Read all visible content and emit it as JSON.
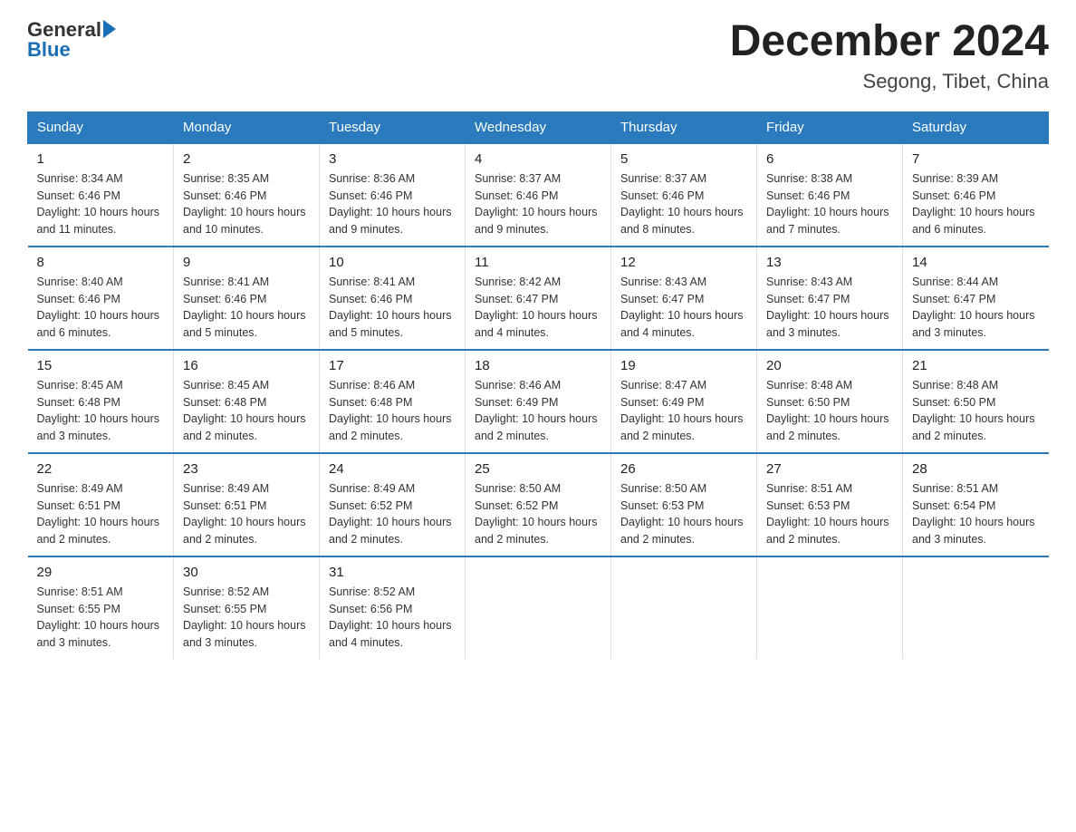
{
  "logo": {
    "general": "General",
    "blue": "Blue"
  },
  "title": "December 2024",
  "subtitle": "Segong, Tibet, China",
  "days_of_week": [
    "Sunday",
    "Monday",
    "Tuesday",
    "Wednesday",
    "Thursday",
    "Friday",
    "Saturday"
  ],
  "weeks": [
    [
      {
        "day": "1",
        "sunrise": "8:34 AM",
        "sunset": "6:46 PM",
        "daylight": "10 hours and 11 minutes."
      },
      {
        "day": "2",
        "sunrise": "8:35 AM",
        "sunset": "6:46 PM",
        "daylight": "10 hours and 10 minutes."
      },
      {
        "day": "3",
        "sunrise": "8:36 AM",
        "sunset": "6:46 PM",
        "daylight": "10 hours and 9 minutes."
      },
      {
        "day": "4",
        "sunrise": "8:37 AM",
        "sunset": "6:46 PM",
        "daylight": "10 hours and 9 minutes."
      },
      {
        "day": "5",
        "sunrise": "8:37 AM",
        "sunset": "6:46 PM",
        "daylight": "10 hours and 8 minutes."
      },
      {
        "day": "6",
        "sunrise": "8:38 AM",
        "sunset": "6:46 PM",
        "daylight": "10 hours and 7 minutes."
      },
      {
        "day": "7",
        "sunrise": "8:39 AM",
        "sunset": "6:46 PM",
        "daylight": "10 hours and 6 minutes."
      }
    ],
    [
      {
        "day": "8",
        "sunrise": "8:40 AM",
        "sunset": "6:46 PM",
        "daylight": "10 hours and 6 minutes."
      },
      {
        "day": "9",
        "sunrise": "8:41 AM",
        "sunset": "6:46 PM",
        "daylight": "10 hours and 5 minutes."
      },
      {
        "day": "10",
        "sunrise": "8:41 AM",
        "sunset": "6:46 PM",
        "daylight": "10 hours and 5 minutes."
      },
      {
        "day": "11",
        "sunrise": "8:42 AM",
        "sunset": "6:47 PM",
        "daylight": "10 hours and 4 minutes."
      },
      {
        "day": "12",
        "sunrise": "8:43 AM",
        "sunset": "6:47 PM",
        "daylight": "10 hours and 4 minutes."
      },
      {
        "day": "13",
        "sunrise": "8:43 AM",
        "sunset": "6:47 PM",
        "daylight": "10 hours and 3 minutes."
      },
      {
        "day": "14",
        "sunrise": "8:44 AM",
        "sunset": "6:47 PM",
        "daylight": "10 hours and 3 minutes."
      }
    ],
    [
      {
        "day": "15",
        "sunrise": "8:45 AM",
        "sunset": "6:48 PM",
        "daylight": "10 hours and 3 minutes."
      },
      {
        "day": "16",
        "sunrise": "8:45 AM",
        "sunset": "6:48 PM",
        "daylight": "10 hours and 2 minutes."
      },
      {
        "day": "17",
        "sunrise": "8:46 AM",
        "sunset": "6:48 PM",
        "daylight": "10 hours and 2 minutes."
      },
      {
        "day": "18",
        "sunrise": "8:46 AM",
        "sunset": "6:49 PM",
        "daylight": "10 hours and 2 minutes."
      },
      {
        "day": "19",
        "sunrise": "8:47 AM",
        "sunset": "6:49 PM",
        "daylight": "10 hours and 2 minutes."
      },
      {
        "day": "20",
        "sunrise": "8:48 AM",
        "sunset": "6:50 PM",
        "daylight": "10 hours and 2 minutes."
      },
      {
        "day": "21",
        "sunrise": "8:48 AM",
        "sunset": "6:50 PM",
        "daylight": "10 hours and 2 minutes."
      }
    ],
    [
      {
        "day": "22",
        "sunrise": "8:49 AM",
        "sunset": "6:51 PM",
        "daylight": "10 hours and 2 minutes."
      },
      {
        "day": "23",
        "sunrise": "8:49 AM",
        "sunset": "6:51 PM",
        "daylight": "10 hours and 2 minutes."
      },
      {
        "day": "24",
        "sunrise": "8:49 AM",
        "sunset": "6:52 PM",
        "daylight": "10 hours and 2 minutes."
      },
      {
        "day": "25",
        "sunrise": "8:50 AM",
        "sunset": "6:52 PM",
        "daylight": "10 hours and 2 minutes."
      },
      {
        "day": "26",
        "sunrise": "8:50 AM",
        "sunset": "6:53 PM",
        "daylight": "10 hours and 2 minutes."
      },
      {
        "day": "27",
        "sunrise": "8:51 AM",
        "sunset": "6:53 PM",
        "daylight": "10 hours and 2 minutes."
      },
      {
        "day": "28",
        "sunrise": "8:51 AM",
        "sunset": "6:54 PM",
        "daylight": "10 hours and 3 minutes."
      }
    ],
    [
      {
        "day": "29",
        "sunrise": "8:51 AM",
        "sunset": "6:55 PM",
        "daylight": "10 hours and 3 minutes."
      },
      {
        "day": "30",
        "sunrise": "8:52 AM",
        "sunset": "6:55 PM",
        "daylight": "10 hours and 3 minutes."
      },
      {
        "day": "31",
        "sunrise": "8:52 AM",
        "sunset": "6:56 PM",
        "daylight": "10 hours and 4 minutes."
      },
      null,
      null,
      null,
      null
    ]
  ]
}
